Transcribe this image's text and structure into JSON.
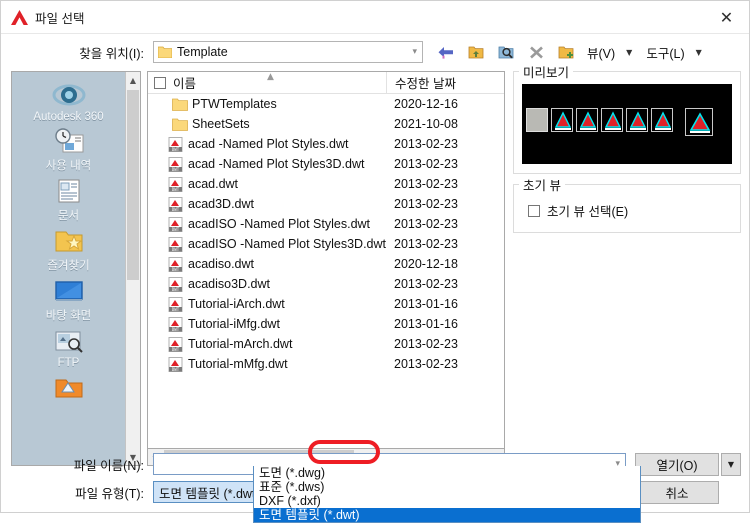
{
  "window": {
    "title": "파일 선택",
    "logo_icon": "autocad-logo-icon",
    "close_icon": "close-icon"
  },
  "path_bar": {
    "label": "찾을 위치(I):",
    "value": "Template",
    "folder_icon": "folder-icon",
    "caret_icon": "chevron-down-icon",
    "toolbar": {
      "back_icon": "back-arrow-icon",
      "up_icon": "up-folder-icon",
      "search_icon": "search-folder-icon",
      "delete_icon": "delete-x-icon",
      "newfolder_icon": "new-folder-icon",
      "view_label": "뷰(V)",
      "view_arrow_icon": "chevron-down-icon",
      "tools_label": "도구(L)",
      "tools_arrow_icon": "chevron-down-icon"
    }
  },
  "places": {
    "items": [
      {
        "label": "Autodesk 360",
        "icon": "autodesk360-icon"
      },
      {
        "label": "사용 내역",
        "icon": "history-icon"
      },
      {
        "label": "문서",
        "icon": "documents-icon"
      },
      {
        "label": "즐겨찾기",
        "icon": "favorites-folder-icon"
      },
      {
        "label": "바탕 화면",
        "icon": "desktop-icon"
      },
      {
        "label": "FTP",
        "icon": "ftp-icon"
      },
      {
        "label": "",
        "icon": "buzzsaw-folder-icon"
      }
    ],
    "scroll_up_icon": "chevron-up-icon",
    "scroll_down_icon": "chevron-down-icon"
  },
  "file_list": {
    "columns": {
      "name": "이름",
      "date": "수정한 날짜"
    },
    "header_checkbox_icon": "checkbox-icon",
    "sort_indicator_icon": "sort-ascending-icon",
    "rows": [
      {
        "name": "PTWTemplates",
        "date": "2020-12-16",
        "type": "folder"
      },
      {
        "name": "SheetSets",
        "date": "2021-10-08",
        "type": "folder"
      },
      {
        "name": "acad -Named Plot Styles.dwt",
        "date": "2013-02-23",
        "type": "dwt"
      },
      {
        "name": "acad -Named Plot Styles3D.dwt",
        "date": "2013-02-23",
        "type": "dwt"
      },
      {
        "name": "acad.dwt",
        "date": "2013-02-23",
        "type": "dwt"
      },
      {
        "name": "acad3D.dwt",
        "date": "2013-02-23",
        "type": "dwt"
      },
      {
        "name": "acadISO -Named Plot Styles.dwt",
        "date": "2013-02-23",
        "type": "dwt"
      },
      {
        "name": "acadISO -Named Plot Styles3D.dwt",
        "date": "2013-02-23",
        "type": "dwt"
      },
      {
        "name": "acadiso.dwt",
        "date": "2020-12-18",
        "type": "dwt"
      },
      {
        "name": "acadiso3D.dwt",
        "date": "2013-02-23",
        "type": "dwt"
      },
      {
        "name": "Tutorial-iArch.dwt",
        "date": "2013-01-16",
        "type": "dwt"
      },
      {
        "name": "Tutorial-iMfg.dwt",
        "date": "2013-01-16",
        "type": "dwt"
      },
      {
        "name": "Tutorial-mArch.dwt",
        "date": "2013-02-23",
        "type": "dwt"
      },
      {
        "name": "Tutorial-mMfg.dwt",
        "date": "2013-02-23",
        "type": "dwt"
      }
    ],
    "hscroll_left_icon": "chevron-left-icon",
    "hscroll_right_icon": "chevron-right-icon"
  },
  "preview": {
    "title": "미리보기"
  },
  "initial_view": {
    "title": "초기 뷰",
    "checkbox_label": "초기 뷰 선택(E)",
    "checkbox_icon": "checkbox-icon",
    "checked": false
  },
  "footer": {
    "filename_label": "파일 이름(N):",
    "filename_value": "",
    "filetype_label": "파일 유형(T):",
    "filetype_value": "도면 템플릿 (*.dwt)",
    "open_button": "열기(O)",
    "open_split_icon": "chevron-down-icon",
    "cancel_button": "취소",
    "caret_icon": "chevron-down-icon"
  },
  "filetype_dropdown": {
    "open": true,
    "options": [
      {
        "label": "도면 (*.dwg)",
        "selected": false
      },
      {
        "label": "표준 (*.dws)",
        "selected": false
      },
      {
        "label": "DXF (*.dxf)",
        "selected": false
      },
      {
        "label": "도면 템플릿 (*.dwt)",
        "selected": true
      }
    ]
  },
  "annotation": {
    "shape": "red-rounded-rectangle",
    "target_text": "(*.dwt)",
    "color": "#ee1d24"
  },
  "colors": {
    "selection_blue": "#0a6fd0",
    "combo_blue_fill": "#cfe3f7",
    "places_background": "#b8c8d4",
    "annotation_red": "#ee1d24"
  }
}
